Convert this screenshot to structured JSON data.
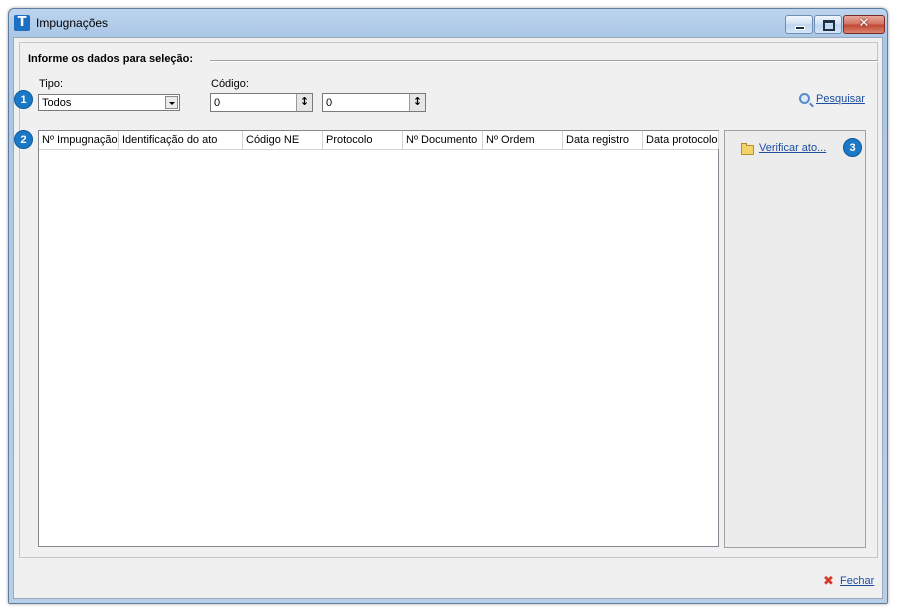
{
  "window": {
    "title": "Impugnações",
    "app_icon_letter": "T"
  },
  "filter": {
    "section_title": "Informe os dados para seleção:",
    "badge1": "1",
    "tipo_label": "Tipo:",
    "tipo_value": "Todos",
    "codigo_label": "Código:",
    "codigo_from": "0",
    "codigo_to": "0",
    "search_label": "Pesquisar"
  },
  "grid": {
    "badge2": "2",
    "columns": [
      "Nº Impugnação",
      "Identificação do ato",
      "Código NE",
      "Protocolo",
      "Nº Documento",
      "Nº Ordem",
      "Data registro",
      "Data protocolo"
    ],
    "rows": []
  },
  "side": {
    "verify_label": "Verificar ato...",
    "badge3": "3"
  },
  "footer": {
    "close_label": "Fechar"
  },
  "colors": {
    "accent_badge": "#1a78c6",
    "link": "#1c4fa0",
    "close_icon": "#d63a2a"
  },
  "icons": [
    "app-icon",
    "minimize-icon",
    "maximize-icon",
    "close-icon",
    "search-icon",
    "folder-open-icon",
    "close-x-icon",
    "dropdown-arrow-icon",
    "spin-arrows-icon"
  ]
}
